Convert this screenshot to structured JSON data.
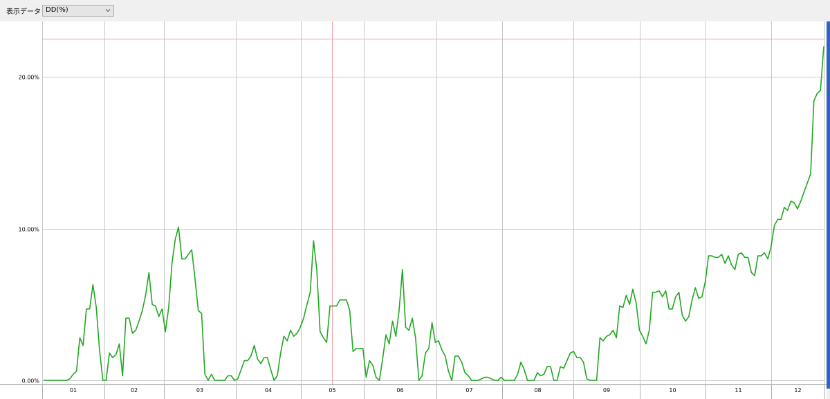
{
  "toolbar": {
    "data_label": "表示データ",
    "selected_option": "DD(%)",
    "dropdown_icon": "chevron-down-icon"
  },
  "chart_data": {
    "type": "line",
    "title": "",
    "xlabel": "",
    "ylabel": "",
    "ylim": [
      0,
      23.5
    ],
    "yticks": [
      0,
      10,
      20
    ],
    "ytick_labels": [
      "0.00%",
      "10.00%",
      "20.00%"
    ],
    "x_tick_labels": [
      "01",
      "02",
      "03",
      "04",
      "05",
      "06",
      "07",
      "08",
      "09",
      "10",
      "11",
      "12"
    ],
    "grid": true,
    "line_color": "#1fa81f",
    "marker_line": {
      "x": 5.0,
      "y": 22.5,
      "color": "#f0a0a0"
    },
    "series": [
      {
        "values": [
          0,
          0,
          0,
          0,
          0,
          0,
          0,
          0,
          0.1,
          0.4,
          0.6,
          2.8,
          2.3,
          4.7,
          4.7,
          6.3,
          4.8,
          2.0,
          0,
          0,
          1.8,
          1.5,
          1.7,
          2.4,
          0.3,
          4.1,
          4.1,
          3.1,
          3.3,
          3.9,
          4.6,
          5.6,
          7.1,
          5.0,
          4.9,
          4.2,
          4.7,
          3.2,
          4.8,
          7.7,
          9.3,
          10.1,
          8.0,
          8.0,
          8.3,
          8.6,
          6.7,
          4.6,
          4.4,
          0.4,
          0,
          0.4,
          0,
          0,
          0,
          0,
          0.3,
          0.3,
          0,
          0.1,
          0.7,
          1.3,
          1.3,
          1.6,
          2.3,
          1.4,
          1.1,
          1.5,
          1.5,
          0.7,
          0,
          0.3,
          1.8,
          2.9,
          2.6,
          3.3,
          2.9,
          3.1,
          3.5,
          4.1,
          5.0,
          5.8,
          9.2,
          7.3,
          3.2,
          2.8,
          2.5,
          4.9,
          4.9,
          4.9,
          5.3,
          5.3,
          5.3,
          4.6,
          1.9,
          2.1,
          2.1,
          2.1,
          0.2,
          1.3,
          1.0,
          0.2,
          0,
          1.4,
          3.0,
          2.4,
          3.9,
          2.9,
          4.6,
          7.3,
          3.5,
          3.3,
          4.1,
          2.8,
          0,
          0.3,
          1.8,
          2.1,
          3.8,
          2.5,
          2.6,
          2.0,
          1.6,
          0.6,
          0,
          1.6,
          1.6,
          1.2,
          0.5,
          0.3,
          0,
          0,
          0,
          0.1,
          0.2,
          0.2,
          0.1,
          0,
          0,
          0.2,
          0,
          0,
          0,
          0,
          0.4,
          1.2,
          0.7,
          0,
          0,
          0,
          0.5,
          0.3,
          0.4,
          0.9,
          0.9,
          0,
          0,
          0.9,
          0.8,
          1.3,
          1.8,
          1.9,
          1.5,
          1.5,
          1.2,
          0.1,
          0,
          0,
          0,
          2.8,
          2.6,
          2.9,
          3.0,
          3.3,
          2.8,
          4.9,
          4.8,
          5.6,
          5.0,
          6.0,
          5.1,
          3.3,
          2.9,
          2.4,
          3.3,
          5.8,
          5.8,
          5.9,
          5.5,
          5.9,
          4.7,
          4.7,
          5.5,
          5.8,
          4.3,
          3.9,
          4.2,
          5.3,
          6.1,
          5.4,
          5.5,
          6.5,
          8.2,
          8.2,
          8.1,
          8.1,
          8.3,
          7.7,
          8.2,
          7.6,
          7.3,
          8.3,
          8.4,
          8.1,
          8.1,
          7.1,
          6.9,
          8.2,
          8.2,
          8.4,
          8.0,
          8.8,
          10.2,
          10.6,
          10.6,
          11.4,
          11.2,
          11.8,
          11.7,
          11.3,
          11.8,
          12.4,
          13.0,
          13.6,
          18.4,
          18.9,
          19.1,
          22.0
        ]
      }
    ]
  }
}
